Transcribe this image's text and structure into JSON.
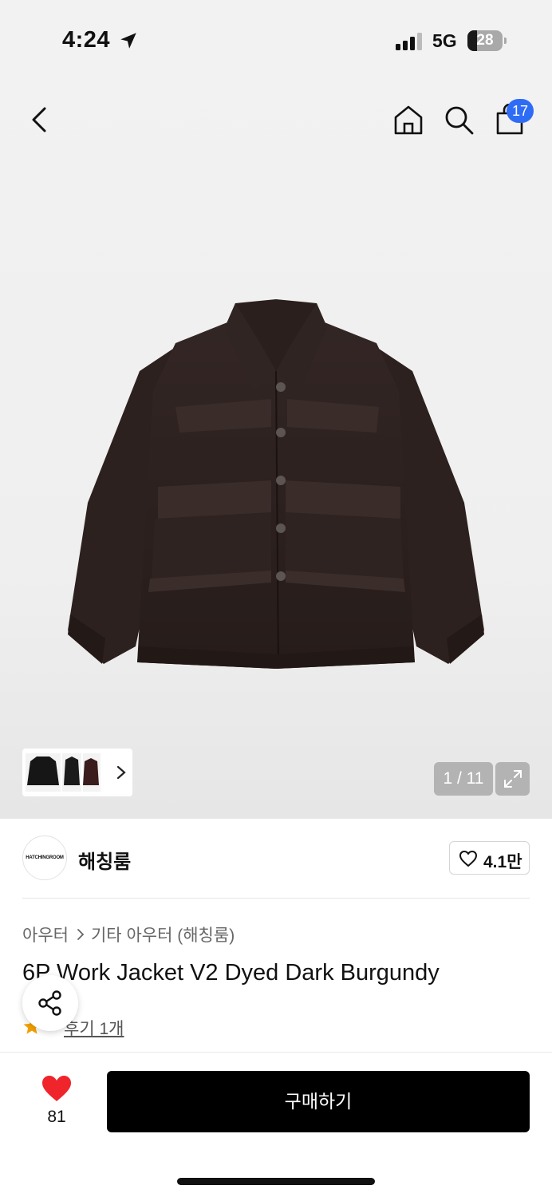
{
  "status_bar": {
    "time": "4:24",
    "network": "5G",
    "battery": "28",
    "battery_level_percent": 28
  },
  "top_nav": {
    "cart_count": "17",
    "icons": [
      "back-icon",
      "home-icon",
      "search-icon",
      "shopping-bag-icon"
    ]
  },
  "gallery": {
    "page_indicator": "1 / 11"
  },
  "brand": {
    "logo_text": "HATCHINGROOM",
    "name": "해칭룸",
    "likes": "4.1만"
  },
  "breadcrumb": {
    "category": "아우터",
    "subcategory": "기타 아우터 (해칭룸)"
  },
  "product": {
    "title": "6P Work Jacket V2 Dyed Dark Burgundy",
    "rating": "5",
    "review_link": "후기 1개"
  },
  "bottom_bar": {
    "wish_count": "81",
    "buy_label": "구매하기"
  },
  "colors": {
    "accent_blue": "#2f6cf6",
    "wish_red": "#f0242b",
    "star_orange": "#f5a000",
    "jacket": "#2e2220"
  }
}
